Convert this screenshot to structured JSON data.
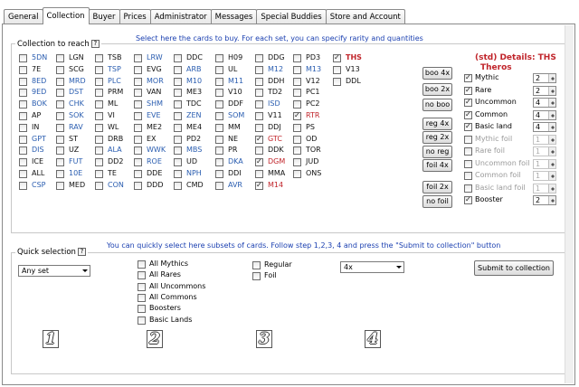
{
  "tabs": [
    "General",
    "Collection",
    "Buyer",
    "Prices",
    "Administrator",
    "Messages",
    "Special Buddies",
    "Store and Account"
  ],
  "active_tab": "Collection",
  "collection": {
    "group_title": "Collection to reach",
    "help": "?",
    "instruction": "Select here the cards to buy. For each set, you can specify rarity and quantities",
    "sets": [
      {
        "code": "5DN",
        "checked": false,
        "color": "#2a5db0"
      },
      {
        "code": "LGN",
        "checked": false,
        "color": "#111111"
      },
      {
        "code": "TSB",
        "checked": false,
        "color": "#111111"
      },
      {
        "code": "LRW",
        "checked": false,
        "color": "#2a5db0"
      },
      {
        "code": "DDC",
        "checked": false,
        "color": "#111111"
      },
      {
        "code": "H09",
        "checked": false,
        "color": "#111111"
      },
      {
        "code": "DDG",
        "checked": false,
        "color": "#111111"
      },
      {
        "code": "PD3",
        "checked": false,
        "color": "#111111"
      },
      {
        "code": "THS",
        "checked": true,
        "color": "#c0242a"
      },
      {
        "code": "7E",
        "checked": false,
        "color": "#111111"
      },
      {
        "code": "SCG",
        "checked": false,
        "color": "#111111"
      },
      {
        "code": "TSP",
        "checked": false,
        "color": "#2a5db0"
      },
      {
        "code": "EVG",
        "checked": false,
        "color": "#111111"
      },
      {
        "code": "ARB",
        "checked": false,
        "color": "#2a5db0"
      },
      {
        "code": "UL",
        "checked": false,
        "color": "#111111"
      },
      {
        "code": "M12",
        "checked": false,
        "color": "#2a5db0"
      },
      {
        "code": "M13",
        "checked": false,
        "color": "#2a5db0"
      },
      {
        "code": "V13",
        "checked": false,
        "color": "#111111"
      },
      {
        "code": "8ED",
        "checked": false,
        "color": "#2a5db0"
      },
      {
        "code": "MRD",
        "checked": false,
        "color": "#2a5db0"
      },
      {
        "code": "PLC",
        "checked": false,
        "color": "#2a5db0"
      },
      {
        "code": "MOR",
        "checked": false,
        "color": "#2a5db0"
      },
      {
        "code": "M10",
        "checked": false,
        "color": "#2a5db0"
      },
      {
        "code": "M11",
        "checked": false,
        "color": "#2a5db0"
      },
      {
        "code": "DDH",
        "checked": false,
        "color": "#111111"
      },
      {
        "code": "V12",
        "checked": false,
        "color": "#111111"
      },
      {
        "code": "DDL",
        "checked": false,
        "color": "#111111"
      },
      {
        "code": "9ED",
        "checked": false,
        "color": "#2a5db0"
      },
      {
        "code": "DST",
        "checked": false,
        "color": "#2a5db0"
      },
      {
        "code": "PRM",
        "checked": false,
        "color": "#111111"
      },
      {
        "code": "VAN",
        "checked": false,
        "color": "#111111"
      },
      {
        "code": "ME3",
        "checked": false,
        "color": "#111111"
      },
      {
        "code": "V10",
        "checked": false,
        "color": "#111111"
      },
      {
        "code": "TD2",
        "checked": false,
        "color": "#111111"
      },
      {
        "code": "PC1",
        "checked": false,
        "color": "#111111"
      },
      {
        "code": "BOK",
        "checked": false,
        "color": "#2a5db0"
      },
      {
        "code": "CHK",
        "checked": false,
        "color": "#2a5db0"
      },
      {
        "code": "ML",
        "checked": false,
        "color": "#111111"
      },
      {
        "code": "SHM",
        "checked": false,
        "color": "#2a5db0"
      },
      {
        "code": "TDC",
        "checked": false,
        "color": "#111111"
      },
      {
        "code": "DDF",
        "checked": false,
        "color": "#111111"
      },
      {
        "code": "ISD",
        "checked": false,
        "color": "#2a5db0"
      },
      {
        "code": "PC2",
        "checked": false,
        "color": "#111111"
      },
      {
        "code": "AP",
        "checked": false,
        "color": "#111111"
      },
      {
        "code": "SOK",
        "checked": false,
        "color": "#2a5db0"
      },
      {
        "code": "VI",
        "checked": false,
        "color": "#111111"
      },
      {
        "code": "EVE",
        "checked": false,
        "color": "#2a5db0"
      },
      {
        "code": "ZEN",
        "checked": false,
        "color": "#2a5db0"
      },
      {
        "code": "SOM",
        "checked": false,
        "color": "#2a5db0"
      },
      {
        "code": "V11",
        "checked": false,
        "color": "#111111"
      },
      {
        "code": "RTR",
        "checked": true,
        "color": "#c0242a"
      },
      {
        "code": "IN",
        "checked": false,
        "color": "#111111"
      },
      {
        "code": "RAV",
        "checked": false,
        "color": "#2a5db0"
      },
      {
        "code": "WL",
        "checked": false,
        "color": "#111111"
      },
      {
        "code": "ME2",
        "checked": false,
        "color": "#111111"
      },
      {
        "code": "ME4",
        "checked": false,
        "color": "#111111"
      },
      {
        "code": "MM",
        "checked": false,
        "color": "#111111"
      },
      {
        "code": "DDJ",
        "checked": false,
        "color": "#111111"
      },
      {
        "code": "PS",
        "checked": false,
        "color": "#111111"
      },
      {
        "code": "GPT",
        "checked": false,
        "color": "#2a5db0"
      },
      {
        "code": "ST",
        "checked": false,
        "color": "#111111"
      },
      {
        "code": "DRB",
        "checked": false,
        "color": "#111111"
      },
      {
        "code": "EX",
        "checked": false,
        "color": "#111111"
      },
      {
        "code": "PD2",
        "checked": false,
        "color": "#111111"
      },
      {
        "code": "NE",
        "checked": false,
        "color": "#111111"
      },
      {
        "code": "GTC",
        "checked": true,
        "color": "#c0242a"
      },
      {
        "code": "OD",
        "checked": false,
        "color": "#111111"
      },
      {
        "code": "DIS",
        "checked": false,
        "color": "#2a5db0"
      },
      {
        "code": "UZ",
        "checked": false,
        "color": "#111111"
      },
      {
        "code": "ALA",
        "checked": false,
        "color": "#2a5db0"
      },
      {
        "code": "WWK",
        "checked": false,
        "color": "#2a5db0"
      },
      {
        "code": "MBS",
        "checked": false,
        "color": "#2a5db0"
      },
      {
        "code": "PR",
        "checked": false,
        "color": "#111111"
      },
      {
        "code": "DDK",
        "checked": false,
        "color": "#111111"
      },
      {
        "code": "TOR",
        "checked": false,
        "color": "#111111"
      },
      {
        "code": "ICE",
        "checked": false,
        "color": "#111111"
      },
      {
        "code": "FUT",
        "checked": false,
        "color": "#2a5db0"
      },
      {
        "code": "DD2",
        "checked": false,
        "color": "#111111"
      },
      {
        "code": "ROE",
        "checked": false,
        "color": "#2a5db0"
      },
      {
        "code": "UD",
        "checked": false,
        "color": "#111111"
      },
      {
        "code": "DKA",
        "checked": false,
        "color": "#2a5db0"
      },
      {
        "code": "DGM",
        "checked": true,
        "color": "#c0242a"
      },
      {
        "code": "JUD",
        "checked": false,
        "color": "#111111"
      },
      {
        "code": "ALL",
        "checked": false,
        "color": "#111111"
      },
      {
        "code": "10E",
        "checked": false,
        "color": "#2a5db0"
      },
      {
        "code": "TE",
        "checked": false,
        "color": "#111111"
      },
      {
        "code": "DDE",
        "checked": false,
        "color": "#111111"
      },
      {
        "code": "NPH",
        "checked": false,
        "color": "#2a5db0"
      },
      {
        "code": "DDI",
        "checked": false,
        "color": "#111111"
      },
      {
        "code": "MMA",
        "checked": false,
        "color": "#111111"
      },
      {
        "code": "ONS",
        "checked": false,
        "color": "#111111"
      },
      {
        "code": "CSP",
        "checked": false,
        "color": "#2a5db0"
      },
      {
        "code": "MED",
        "checked": false,
        "color": "#111111"
      },
      {
        "code": "CON",
        "checked": false,
        "color": "#2a5db0"
      },
      {
        "code": "DDD",
        "checked": false,
        "color": "#111111"
      },
      {
        "code": "CMD",
        "checked": false,
        "color": "#111111"
      },
      {
        "code": "AVR",
        "checked": false,
        "color": "#2a5db0"
      },
      {
        "code": "M14",
        "checked": true,
        "color": "#c0242a"
      }
    ],
    "buttons": [
      "boo 4x",
      "boo 2x",
      "no boo",
      "reg 4x",
      "reg 2x",
      "no reg",
      "foil 4x",
      "foil 2x",
      "no foil"
    ],
    "details_title": "(std) Details: THS",
    "details_subtitle": "Theros",
    "rarities": [
      {
        "label": "Mythic",
        "checked": true,
        "qty": "2",
        "enabled": true
      },
      {
        "label": "Rare",
        "checked": true,
        "qty": "2",
        "enabled": true
      },
      {
        "label": "Uncommon",
        "checked": true,
        "qty": "4",
        "enabled": true
      },
      {
        "label": "Common",
        "checked": true,
        "qty": "4",
        "enabled": true
      },
      {
        "label": "Basic land",
        "checked": true,
        "qty": "4",
        "enabled": true
      },
      {
        "label": "Mythic foil",
        "checked": false,
        "qty": "1",
        "enabled": false
      },
      {
        "label": "Rare foil",
        "checked": false,
        "qty": "1",
        "enabled": false
      },
      {
        "label": "Uncommon foil",
        "checked": false,
        "qty": "1",
        "enabled": false
      },
      {
        "label": "Common foil",
        "checked": false,
        "qty": "1",
        "enabled": false
      },
      {
        "label": "Basic land foil",
        "checked": false,
        "qty": "1",
        "enabled": false
      },
      {
        "label": "Booster",
        "checked": true,
        "qty": "2",
        "enabled": true
      }
    ]
  },
  "quick": {
    "group_title": "Quick selection",
    "help": "?",
    "instruction": "You can quickly select here subsets of cards. Follow step 1,2,3, 4 and press the \"Submit to collection\" button",
    "set_select": "Any set",
    "rarity_options": [
      "All Mythics",
      "All Rares",
      "All Uncommons",
      "All Commons",
      "Boosters",
      "Basic Lands"
    ],
    "foil_options": [
      "Regular",
      "Foil"
    ],
    "qty_select": "4x",
    "submit_label": "Submit to collection",
    "steps": [
      "1",
      "2",
      "3",
      "4"
    ]
  }
}
